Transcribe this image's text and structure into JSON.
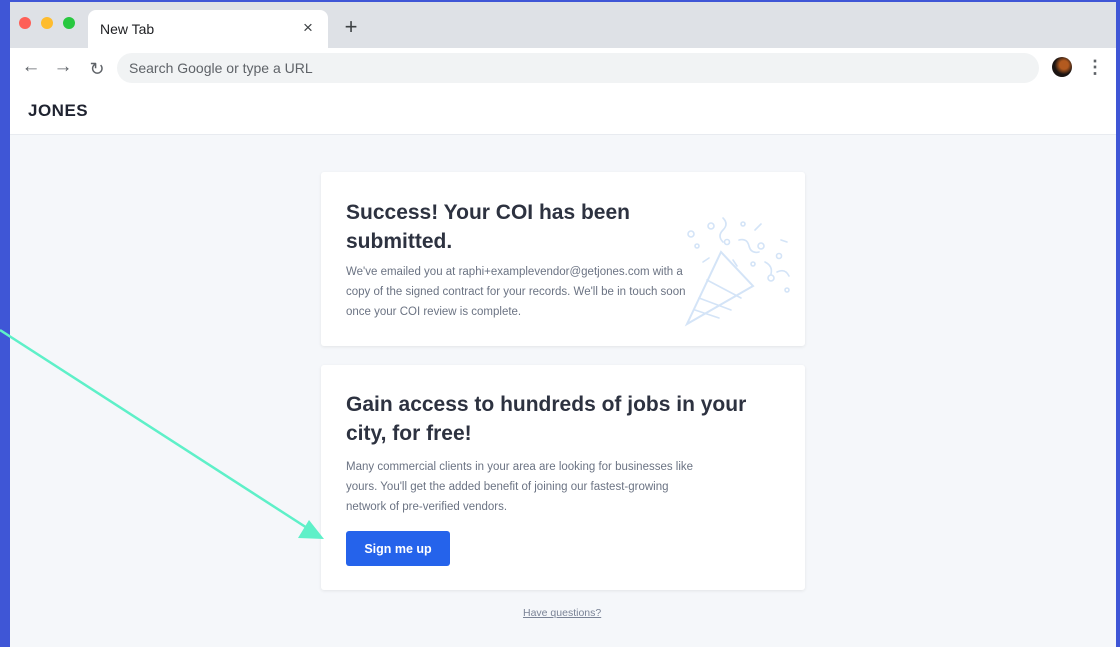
{
  "browser": {
    "tab_title": "New Tab",
    "new_tab_symbol": "+",
    "close_symbol": "×",
    "nav": {
      "back_icon": "arrow-left-icon",
      "forward_icon": "arrow-right-icon",
      "reload_icon": "reload-icon"
    },
    "omnibox": {
      "placeholder": "Search Google or type a URL"
    }
  },
  "page": {
    "brand": "JONES",
    "success_card": {
      "title": "Success! Your COI has been submitted.",
      "body": "We've emailed you at raphi+examplevendor@getjones.com with a copy of the signed contract for your records. We'll be in touch soon once your COI review is complete.",
      "illustration_icon": "party-popper-icon"
    },
    "promo_card": {
      "title": "Gain access to hundreds of jobs in your city, for free!",
      "body": "Many commercial clients in your area are looking for businesses like yours. You'll get the added benefit of joining our fastest-growing network of pre-verified vendors.",
      "button_label": "Sign me up"
    },
    "help_link": "Have questions?"
  },
  "colors": {
    "frame": "#3f56d6",
    "primary_button": "#2563eb",
    "annotation_arrow": "#5ef0c8"
  }
}
